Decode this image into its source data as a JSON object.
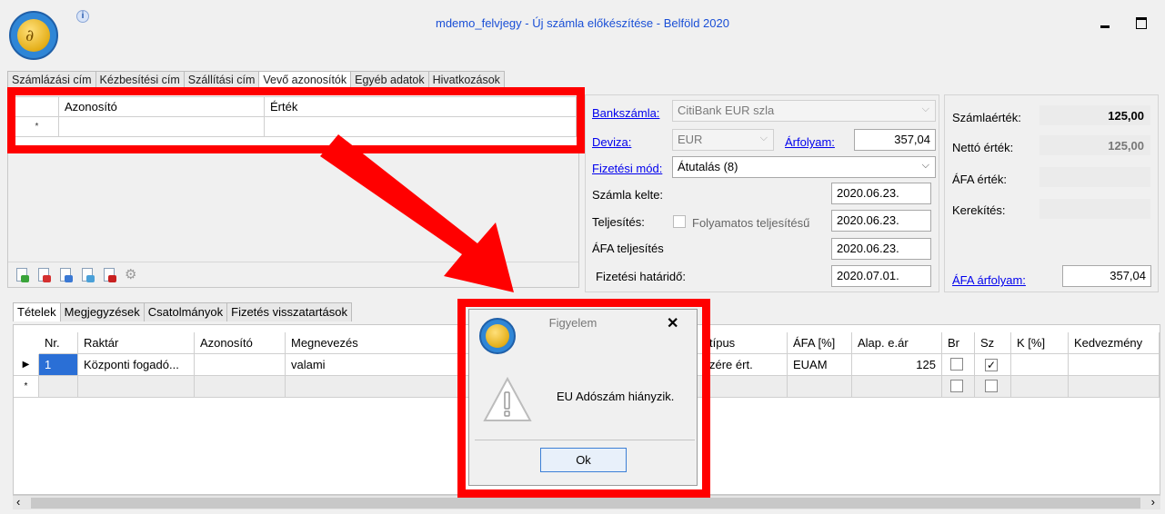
{
  "window": {
    "title": "mdemo_felvjegy - Új számla előkészítése - Belföld 2020",
    "info_icon": "i"
  },
  "top_tabs": [
    "Számlázási cím",
    "Kézbesítési cím",
    "Szállítási cím",
    "Vevő azonosítók",
    "Egyéb adatok",
    "Hivatkozások"
  ],
  "identifiers_grid": {
    "columns": [
      "Azonosító",
      "Érték"
    ],
    "new_row_marker": "*"
  },
  "form": {
    "bankszamla_label": "Bankszámla:",
    "bankszamla_value": "CitiBank EUR szla",
    "deviza_label": "Deviza:",
    "deviza_value": "EUR",
    "arfolyam_label": "Árfolyam:",
    "arfolyam_value": "357,04",
    "fizetesi_mod_label": "Fizetési mód:",
    "fizetesi_mod_value": "Átutalás (8)",
    "szamla_kelte_label": "Számla kelte:",
    "szamla_kelte_value": "2020.06.23.",
    "teljesites_label": "Teljesítés:",
    "folyamatos_label": "Folyamatos teljesítésű",
    "teljesites_value": "2020.06.23.",
    "afa_teljesites_label": "ÁFA teljesítés",
    "afa_teljesites_value": "2020.06.23.",
    "fizetesi_hatarido_label": "Fizetési határidő:",
    "fizetesi_hatarido_value": "2020.07.01."
  },
  "summary": {
    "szamlaertek_label": "Számlaérték:",
    "szamlaertek_value": "125,00",
    "netto_label": "Nettó érték:",
    "netto_value": "125,00",
    "afa_label": "ÁFA érték:",
    "afa_value": "",
    "kerekites_label": "Kerekítés:",
    "kerekites_value": "",
    "afa_arfolyam_label": "ÁFA árfolyam:",
    "afa_arfolyam_value": "357,04"
  },
  "bottom_tabs": [
    "Tételek",
    "Megjegyzések",
    "Csatolmányok",
    "Fizetés visszatartások"
  ],
  "items_grid": {
    "columns": {
      "nr": "Nr.",
      "raktar": "Raktár",
      "azonosito": "Azonosító",
      "megnevezes": "Megnevezés",
      "tipus": "típus",
      "afa": "ÁFA [%]",
      "alap_ar": "Alap. e.ár",
      "br": "Br",
      "sz": "Sz",
      "k": "K [%]",
      "kedvezmeny": "Kedvezmény"
    },
    "rows": [
      {
        "marker": "▶",
        "nr": "1",
        "raktar": "Központi fogadó...",
        "azonosito": "",
        "megnevezes": "valami",
        "tipus": "zére ért.",
        "afa": "EUAM",
        "alap_ar": "125",
        "br_checked": false,
        "sz_checked": true
      }
    ],
    "new_row_marker": "*"
  },
  "dialog": {
    "title": "Figyelem",
    "close": "✕",
    "message": "EU Adószám hiányzik.",
    "ok_label": "Ok"
  },
  "annotation": {
    "color": "#ff0000"
  }
}
